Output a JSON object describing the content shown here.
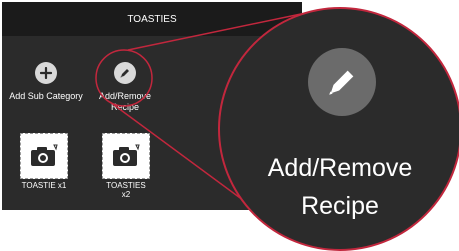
{
  "header": {
    "title": "TOASTIES"
  },
  "tiles": [
    {
      "label": "Add Sub Category",
      "icon": "plus-icon"
    },
    {
      "label": "Add/Remove\nRecipe",
      "icon": "pencil-icon"
    }
  ],
  "items": [
    {
      "label": "TOASTIE x1",
      "icon": "camera-icon"
    },
    {
      "label": "TOASTIES\nx2",
      "icon": "camera-icon"
    }
  ],
  "callout": {
    "label_line1": "Add/Remove",
    "label_line2": "Recipe",
    "icon": "pencil-icon"
  },
  "colors": {
    "highlight": "#c2273d",
    "panel": "#2b2b2b",
    "header": "#1b1b1b",
    "button": "#d9d9d9"
  }
}
